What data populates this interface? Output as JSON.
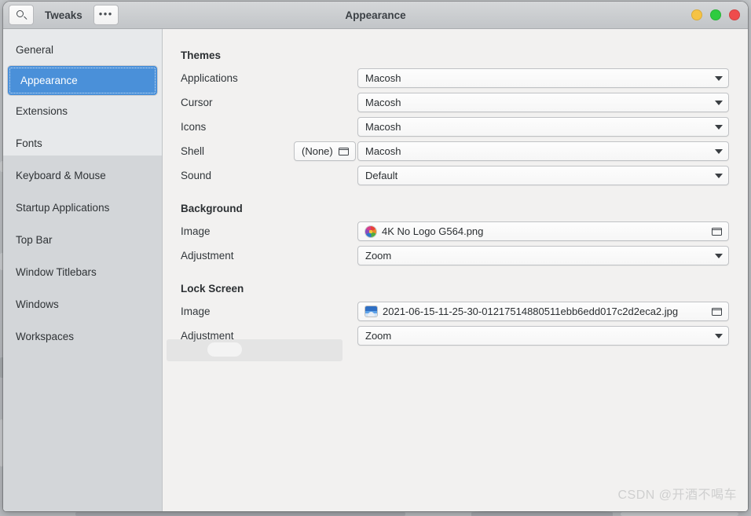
{
  "window": {
    "app_name": "Tweaks",
    "title": "Appearance",
    "search_icon": "search-icon",
    "menu_icon": "ellipsis-icon",
    "controls": [
      {
        "name": "minimize-button",
        "color": "#f6c344"
      },
      {
        "name": "maximize-button",
        "color": "#2ecc40"
      },
      {
        "name": "close-button",
        "color": "#ef4c4c"
      }
    ]
  },
  "sidebar": {
    "items": [
      {
        "label": "General",
        "selected": false
      },
      {
        "label": "Appearance",
        "selected": true
      },
      {
        "label": "Extensions",
        "selected": false
      },
      {
        "label": "Fonts",
        "selected": false
      },
      {
        "label": "Keyboard & Mouse",
        "selected": false
      },
      {
        "label": "Startup Applications",
        "selected": false
      },
      {
        "label": "Top Bar",
        "selected": false
      },
      {
        "label": "Window Titlebars",
        "selected": false
      },
      {
        "label": "Windows",
        "selected": false
      },
      {
        "label": "Workspaces",
        "selected": false
      }
    ],
    "selected_color": "#4a90d9"
  },
  "content": {
    "themes": {
      "heading": "Themes",
      "applications": {
        "label": "Applications",
        "value": "Macosh"
      },
      "cursor": {
        "label": "Cursor",
        "value": "Macosh"
      },
      "icons": {
        "label": "Icons",
        "value": "Macosh"
      },
      "shell": {
        "label": "Shell",
        "file_value": "(None)",
        "value": "Macosh"
      },
      "sound": {
        "label": "Sound",
        "value": "Default"
      }
    },
    "background": {
      "heading": "Background",
      "image": {
        "label": "Image",
        "value": "4K No Logo G564.png",
        "icon": "image-thumbnail-icon"
      },
      "adjustment": {
        "label": "Adjustment",
        "value": "Zoom"
      }
    },
    "lock_screen": {
      "heading": "Lock Screen",
      "image": {
        "label": "Image",
        "value": "2021-06-15-11-25-30-01217514880511ebb6edd017c2d2eca2.jpg",
        "icon": "image-thumbnail-icon"
      },
      "adjustment": {
        "label": "Adjustment",
        "value": "Zoom"
      }
    }
  },
  "watermark": {
    "text": "CSDN @开酒不喝车"
  }
}
